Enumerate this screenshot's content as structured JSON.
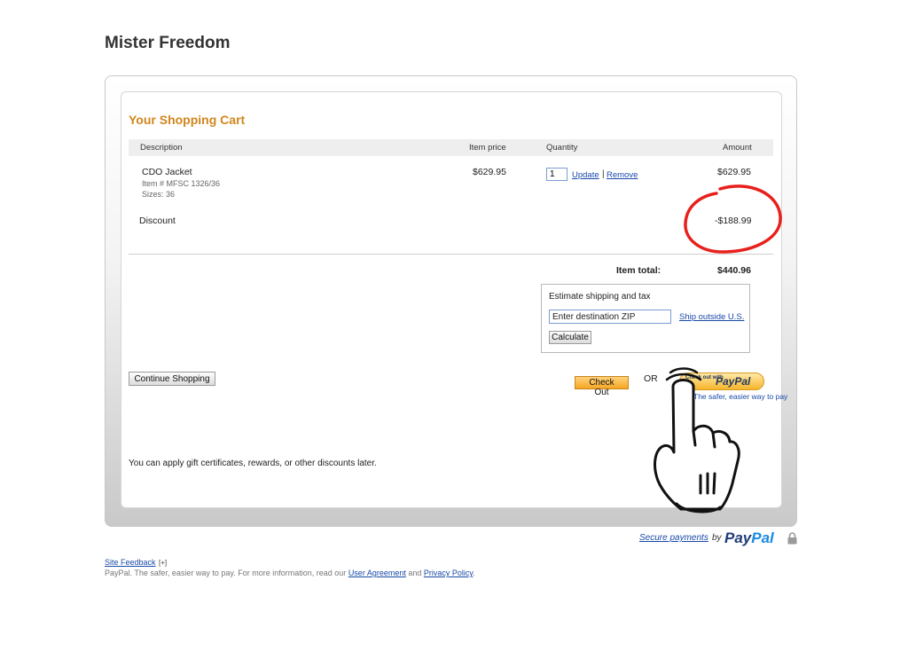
{
  "merchant_name": "Mister Freedom",
  "cart": {
    "title": "Your Shopping Cart",
    "columns": {
      "description": "Description",
      "item_price": "Item price",
      "quantity": "Quantity",
      "amount": "Amount"
    },
    "items": [
      {
        "name": "CDO Jacket",
        "item_number": "Item # MFSC 1326/36",
        "size": "Sizes: 36",
        "price": "$629.95",
        "quantity": "1",
        "update_label": "Update",
        "separator": "|",
        "remove_label": "Remove",
        "amount": "$629.95"
      }
    ],
    "discount": {
      "label": "Discount",
      "amount": "-$188.99"
    },
    "item_total_label": "Item total:",
    "item_total_value": "$440.96"
  },
  "shipping": {
    "title": "Estimate shipping and tax",
    "zip_value": "Enter destination ZIP",
    "ship_outside_label": "Ship outside U.S.",
    "calculate_label": "Calculate"
  },
  "actions": {
    "continue_shopping": "Continue Shopping",
    "check_out": "Check Out",
    "or_label": "OR",
    "paypal_button_small": "Check out with",
    "paypal_button_word": "PayPal",
    "paypal_tagline": "The safer, easier way to pay"
  },
  "gift_note": "You can apply gift certificates, rewards, or other discounts later.",
  "footer": {
    "secure_payments": "Secure payments",
    "by": "by",
    "logo_pay": "Pay",
    "logo_pal": "Pal",
    "site_feedback": "Site Feedback",
    "feedback_plus": "[+]",
    "text_before": "PayPal. The safer, easier way to pay. For more information, read our",
    "user_agreement": "User Agreement",
    "and": "and",
    "privacy_policy": "Privacy Policy",
    "text_after": "."
  },
  "colors": {
    "cart_title": "#d2861c",
    "link": "#1a4aa8",
    "annotation_circle": "#e8201c",
    "checkout_button": "#f5a623"
  },
  "icons": [
    "lock-icon",
    "pointing-hand-icon"
  ]
}
